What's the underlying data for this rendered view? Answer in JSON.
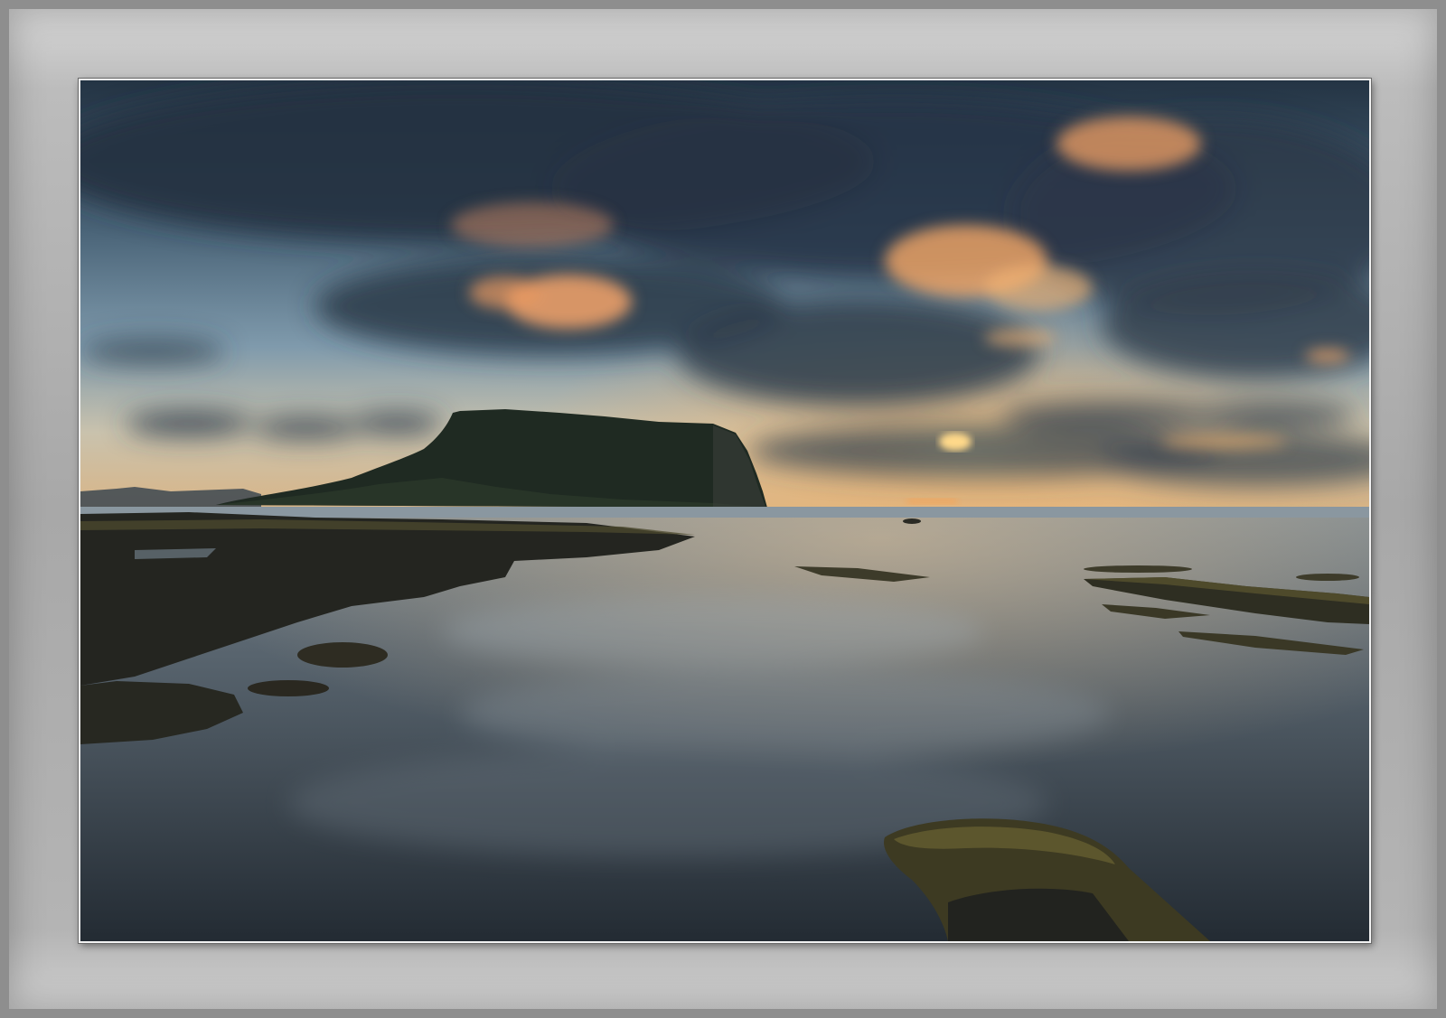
{
  "frame": {
    "mat_color": "#a8a8a8",
    "border_color": "#f2f2f2"
  },
  "scene": {
    "sky_colors": [
      "#2a3b4c",
      "#4f6a80",
      "#8fa9b8",
      "#e8c99a",
      "#f3b46a"
    ],
    "cloud_highlight": "#f4a063",
    "cloud_dark": "#2d3a47",
    "headland_color": "#1f2a22",
    "water_colors": [
      "#6b7a85",
      "#4d5964",
      "#2a333c"
    ],
    "rock_color": "#2a2a22",
    "moss_color": "#4f4a2a",
    "sun_color": "#ffd27a"
  }
}
